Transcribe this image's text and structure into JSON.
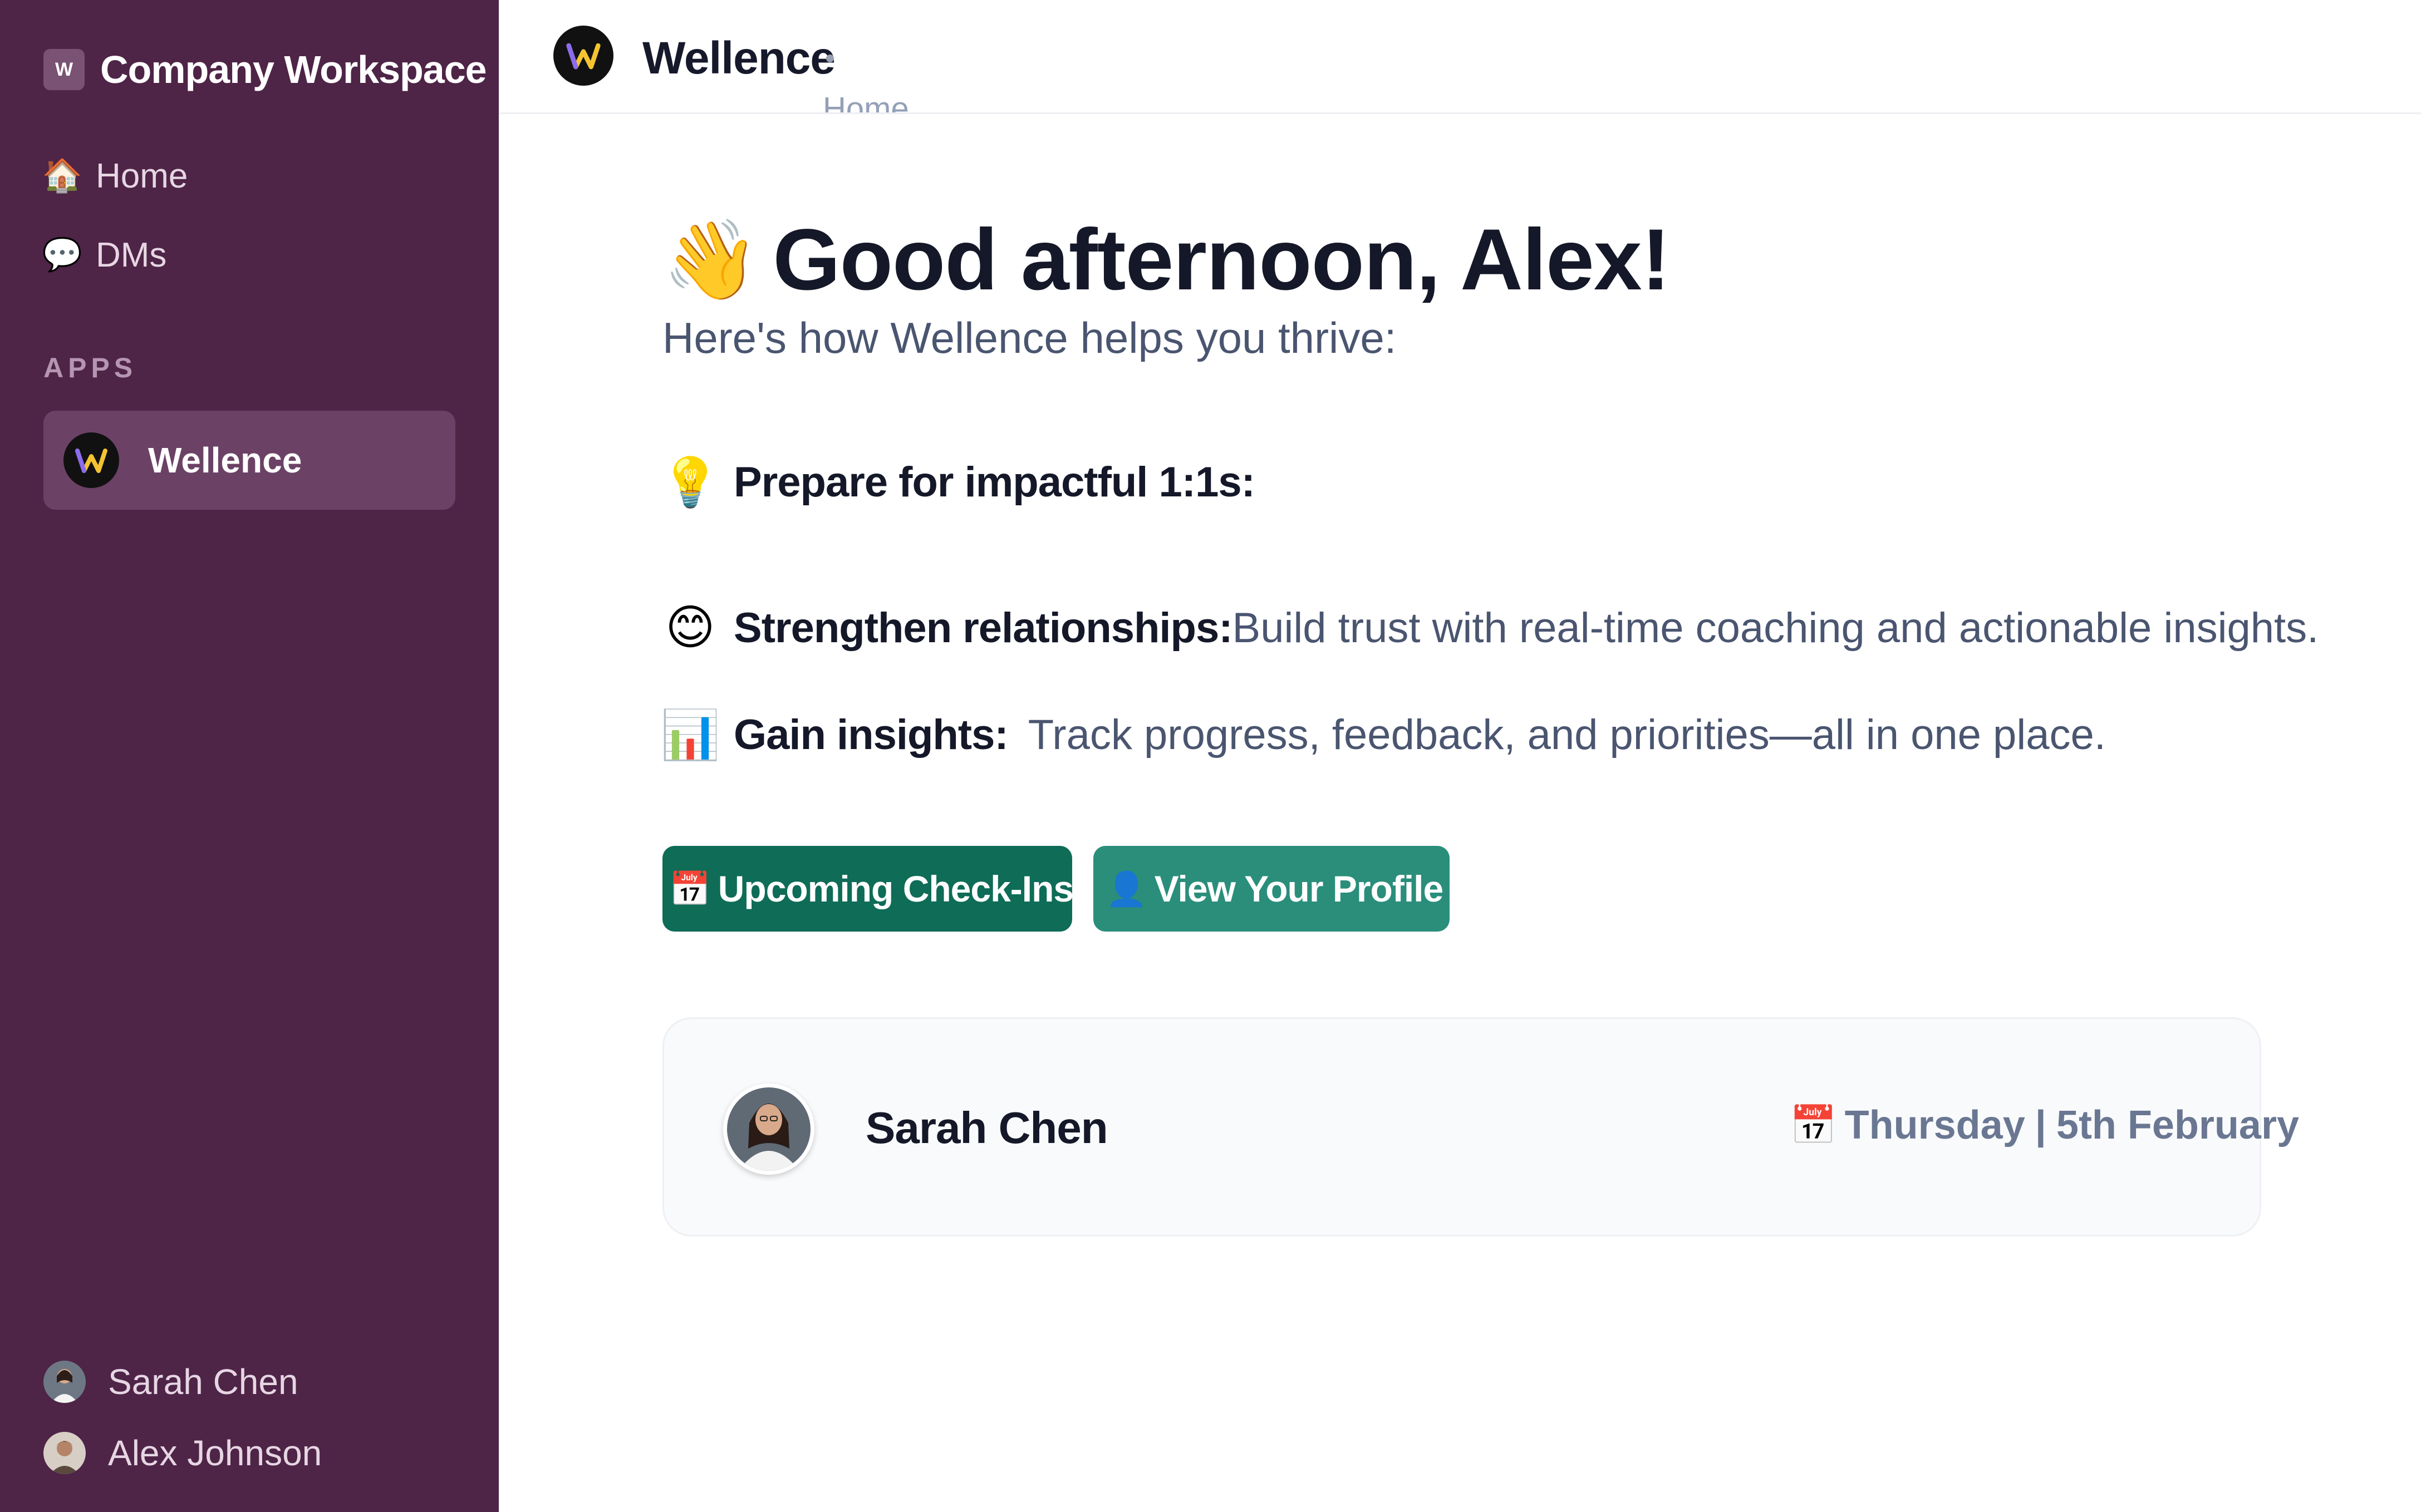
{
  "workspace": {
    "logo_letter": "W",
    "name": "Company Workspace"
  },
  "sidebar": {
    "nav": [
      {
        "label": "Home",
        "icon": "house-icon"
      },
      {
        "label": "DMs",
        "icon": "speech-bubble-icon"
      }
    ],
    "apps_section_label": "APPS",
    "apps": [
      {
        "label": "Wellence",
        "icon": "wellence-logo-icon"
      }
    ],
    "users": [
      {
        "name": "Sarah Chen"
      },
      {
        "name": "Alex Johnson"
      }
    ]
  },
  "topbar": {
    "title": "Wellence",
    "tab_label": "Home"
  },
  "main": {
    "greeting_emoji": "👋",
    "greeting": "Good afternoon, Alex!",
    "subtitle": "Here's how Wellence helps you thrive:",
    "features": [
      {
        "icon": "💡",
        "title": "Prepare for impactful 1:1s:",
        "desc": ""
      },
      {
        "icon": "😊",
        "title": "Strengthen relationships:",
        "desc": "Build trust with real-time coaching and actionable insights."
      },
      {
        "icon": "📊",
        "title": "Gain insights:",
        "desc": "Track progress, feedback, and priorities—all in one place."
      }
    ],
    "buttons": {
      "checkins_icon": "📅",
      "checkins_label": "Upcoming Check-Ins",
      "profile_icon": "👤",
      "profile_label": "View Your Profile"
    },
    "checkin_card": {
      "name": "Sarah Chen",
      "date_icon": "📅",
      "day": "Thursday",
      "separator": "|",
      "date": "5th February"
    }
  },
  "colors": {
    "sidebar_bg": "#4e2447",
    "primary_button": "#0e6c57",
    "secondary_button": "#2a8e7b"
  }
}
